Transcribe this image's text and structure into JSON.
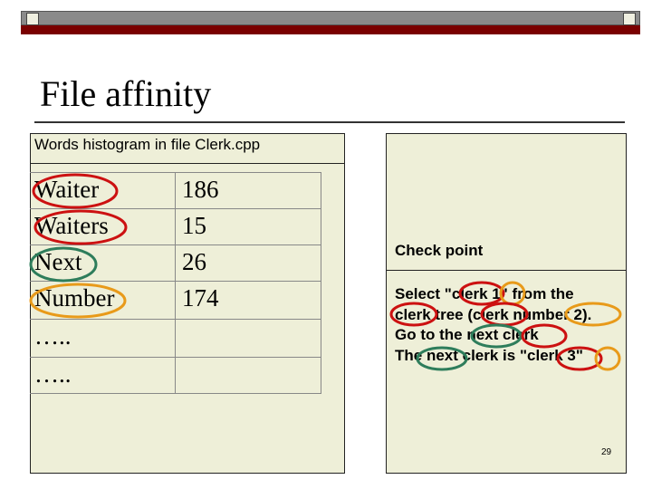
{
  "slide": {
    "title": "File affinity",
    "page_number": "29"
  },
  "left_panel": {
    "caption": "Words histogram in file Clerk.cpp",
    "rows": [
      {
        "word": "Waiter",
        "count": "186",
        "marker_color": "#cc1111"
      },
      {
        "word": "Waiters",
        "count": "15",
        "marker_color": "#cc1111"
      },
      {
        "word": "Next",
        "count": "26",
        "marker_color": "#2e7d5b"
      },
      {
        "word": "Number",
        "count": "174",
        "marker_color": "#e89a1a"
      },
      {
        "word": "…..",
        "count": ""
      },
      {
        "word": "…..",
        "count": ""
      }
    ]
  },
  "right_panel": {
    "heading": "Check point",
    "lines": [
      "Select \"clerk 1\" from the",
      "clerk tree (clerk number 2).",
      "Go to the next clerk",
      "The next clerk is \"clerk 3\""
    ]
  },
  "colors": {
    "header_bar": "#8a8a8a",
    "header_bar_dark": "#7a0000",
    "panel_bg": "#eeefd8",
    "circle_red": "#cc1111",
    "circle_green": "#2e7d5b",
    "circle_orange": "#e89a1a"
  }
}
